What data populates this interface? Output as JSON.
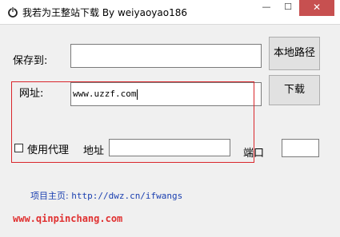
{
  "window": {
    "title": "我若为王整站下载   By weiyaoyao186",
    "minimize_glyph": "—",
    "maximize_glyph": "☐",
    "close_glyph": "✕"
  },
  "form": {
    "save_label": "保存到:",
    "save_value": "",
    "local_path_button": "本地路径",
    "url_label": "网址:",
    "url_value": "www.uzzf.com",
    "download_button": "下载",
    "proxy_checkbox_label": "使用代理",
    "proxy_checked": false,
    "address_label": "地址",
    "address_value": "",
    "port_label": "端口",
    "port_value": ""
  },
  "footer": {
    "homepage_label": "项目主页:",
    "homepage_url": "http://dwz.cn/ifwangs"
  },
  "watermark": "www.qinpinchang.com",
  "colors": {
    "highlight_box": "#d9262b",
    "link": "#1a3fb0",
    "watermark": "#e03030"
  }
}
